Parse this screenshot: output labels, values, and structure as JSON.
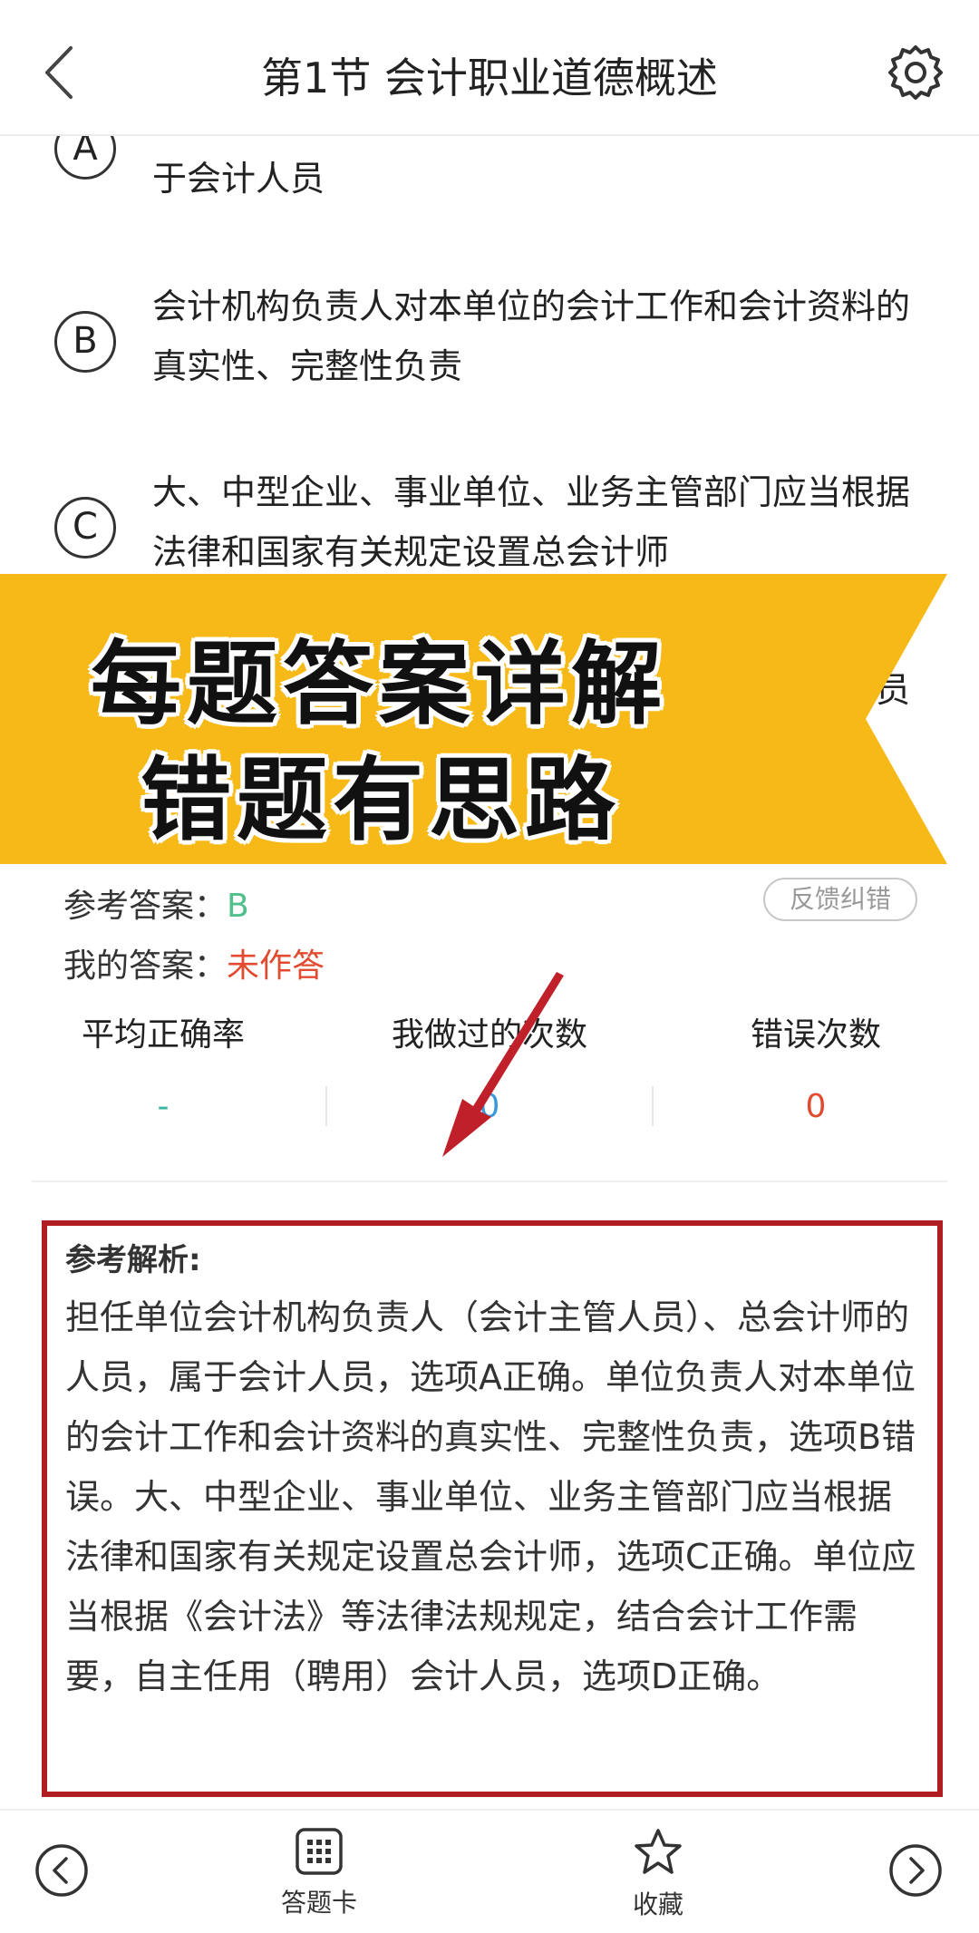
{
  "header": {
    "title": "第1节 会计职业道德概述"
  },
  "options": [
    {
      "letter": "A",
      "text": "于会计人员"
    },
    {
      "letter": "B",
      "text": "会计机构负责人对本单位的会计工作和会计资料的真实性、完整性负责"
    },
    {
      "letter": "C",
      "text": "大、中型企业、事业单位、业务主管部门应当根据法律和国家有关规定设置总会计师"
    }
  ],
  "option_d_tail": "员",
  "banner": {
    "line1": "每题答案详解",
    "line2": "错题有思路",
    "color": "#f7b917"
  },
  "answer": {
    "reference_label": "参考答案：",
    "reference_value": "B",
    "mine_label": "我的答案：",
    "mine_value": "未作答",
    "feedback_label": "反馈纠错"
  },
  "stats": [
    {
      "label": "平均正确率",
      "value": "-",
      "color": "#3ab5a0"
    },
    {
      "label": "我做过的次数",
      "value": "0",
      "color": "#3a9ad9"
    },
    {
      "label": "错误次数",
      "value": "0",
      "color": "#e24b2f"
    }
  ],
  "analysis": {
    "title": "参考解析:",
    "text": "担任单位会计机构负责人（会计主管人员）、总会计师的人员，属于会计人员，选项A正确。单位负责人对本单位的会计工作和会计资料的真实性、完整性负责，选项B错误。大、中型企业、事业单位、业务主管部门应当根据法律和国家有关规定设置总会计师，选项C正确。单位应当根据《会计法》等法律法规规定，结合会计工作需要，自主任用（聘用）会计人员，选项D正确。"
  },
  "bottom_bar": {
    "card_label": "答题卡",
    "favorite_label": "收藏"
  },
  "icons": {
    "back": "chevron-left-icon",
    "settings": "gear-icon",
    "prev": "circle-chevron-left-icon",
    "next": "circle-chevron-right-icon",
    "card": "grid-icon",
    "favorite": "star-icon"
  }
}
